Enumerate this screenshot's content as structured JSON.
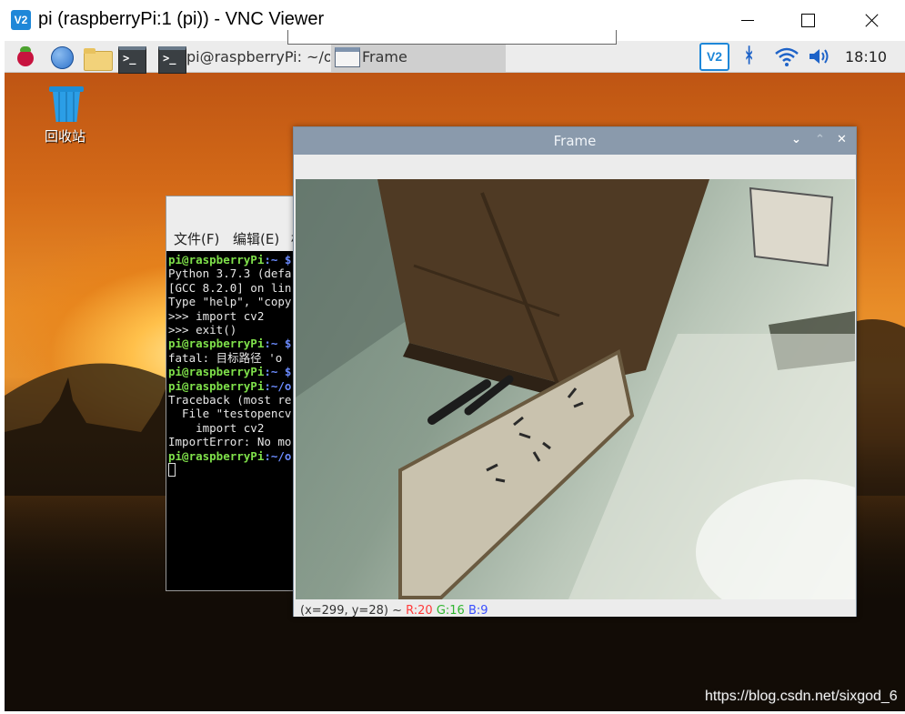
{
  "vnc_window": {
    "logo": "V2",
    "title": "pi (raspberryPi:1 (pi)) - VNC Viewer"
  },
  "taskbar": {
    "icons": [
      "raspberry-menu-icon",
      "web-browser-icon",
      "file-manager-icon",
      "terminal-icon"
    ],
    "terminal_glyph": ">_",
    "tasks": [
      {
        "label": "pi@raspberryPi: ~/o...",
        "icon": "terminal-icon"
      },
      {
        "label": "Frame",
        "icon": "window-icon",
        "active": true
      }
    ],
    "tray": {
      "vnc": "V2",
      "bluetooth": "ᚼ",
      "clock": "18:10"
    }
  },
  "desktop": {
    "trash_label": "回收站"
  },
  "terminal": {
    "menu": [
      "文件(F)",
      "编辑(E)",
      "标"
    ],
    "lines": [
      {
        "user": "pi@raspberryPi",
        "path": ":~ $",
        "text": ""
      },
      {
        "text": "Python 3.7.3 (defa"
      },
      {
        "text": "[GCC 8.2.0] on lin"
      },
      {
        "text": "Type \"help\", \"copy"
      },
      {
        "text": ">>> import cv2"
      },
      {
        "text": ">>> exit()"
      },
      {
        "user": "pi@raspberryPi",
        "path": ":~ $",
        "text": ""
      },
      {
        "text": "fatal: 目标路径 'o"
      },
      {
        "user": "pi@raspberryPi",
        "path": ":~ $",
        "text": ""
      },
      {
        "user": "pi@raspberryPi",
        "path": ":~/o",
        "text": ""
      },
      {
        "text": "Traceback (most re"
      },
      {
        "text": "  File \"testopencv"
      },
      {
        "text": "    import cv2"
      },
      {
        "text": "ImportError: No mo"
      },
      {
        "user": "pi@raspberryPi",
        "path": ":~/o",
        "text": ""
      }
    ]
  },
  "frame_window": {
    "title": "Frame",
    "controls": {
      "minimize": "⌄",
      "maximize": "⌃",
      "close": "✕"
    },
    "status": {
      "coords": "(x=299, y=28) ~",
      "r": "R:20",
      "g": "G:16",
      "b": "B:9"
    }
  },
  "watermark": "https://blog.csdn.net/sixgod_6"
}
